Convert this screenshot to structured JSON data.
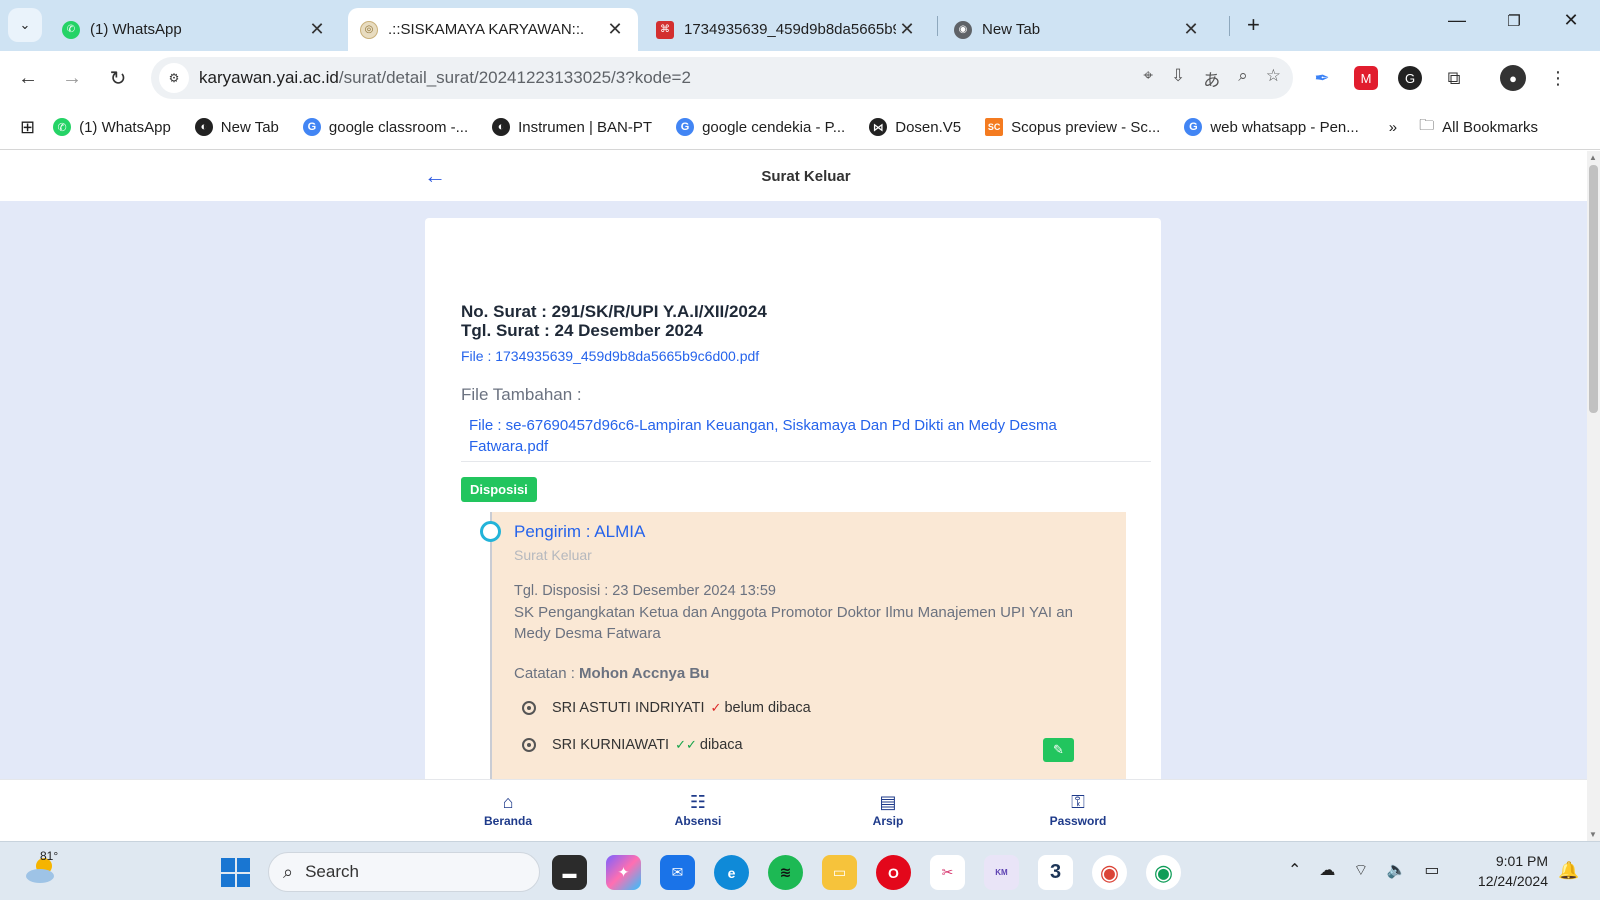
{
  "browser": {
    "tabs": [
      {
        "title": "(1) WhatsApp",
        "favicon_color": "#25D366",
        "favicon_icon": "whatsapp-icon"
      },
      {
        "title": ".::SISKAMAYA KARYAWAN::.",
        "favicon_color": "#c9b07a",
        "favicon_icon": "siskamaya-icon"
      },
      {
        "title": "1734935639_459d9b8da5665b9",
        "favicon_color": "#d32f2f",
        "favicon_icon": "pdf-icon"
      },
      {
        "title": "New Tab",
        "favicon_color": "#5f6368",
        "favicon_icon": "chrome-icon"
      }
    ],
    "url_host": "karyawan.yai.ac.id",
    "url_path": "/surat/detail_surat/20241223133025/3?kode=2",
    "bookmarks": [
      {
        "label": "(1) WhatsApp",
        "color": "#25D366",
        "glyph": "✆"
      },
      {
        "label": "New Tab",
        "color": "#222222",
        "glyph": "◐"
      },
      {
        "label": "google classroom -...",
        "color": "#4285F4",
        "glyph": "G"
      },
      {
        "label": "Instrumen | BAN-PT",
        "color": "#222222",
        "glyph": "◐"
      },
      {
        "label": "google cendekia - P...",
        "color": "#4285F4",
        "glyph": "G"
      },
      {
        "label": "Dosen.V5",
        "color": "#222222",
        "glyph": "⋈"
      },
      {
        "label": "Scopus preview - Sc...",
        "color": "#f47b20",
        "glyph": "SC"
      },
      {
        "label": "web whatsapp - Pen...",
        "color": "#4285F4",
        "glyph": "G"
      }
    ],
    "bookmarks_overflow": "»",
    "all_bookmarks": "All Bookmarks"
  },
  "app": {
    "header_title": "Surat Keluar",
    "surat_no": "No. Surat : 291/SK/R/UPI Y.A.I/XII/2024",
    "surat_tgl": "Tgl. Surat : 24 Desember 2024",
    "file": "File : 1734935639_459d9b8da5665b9c6d00.pdf",
    "file_tambahan_label": "File Tambahan :",
    "file_tambahan": "File : se-67690457d96c6-Lampiran Keuangan, Siskamaya Dan Pd Dikti an Medy Desma Fatwara.pdf",
    "badge": "Disposisi",
    "disposisi": {
      "pengirim": "Pengirim : ALMIA",
      "jenis": "Surat Keluar",
      "tgl": "Tgl. Disposisi : 23 Desember 2024 13:59",
      "perihal": "SK Pengangkatan Ketua dan Anggota Promotor Doktor Ilmu Manajemen UPI YAI an Medy Desma Fatwara",
      "catatan_label": "Catatan : ",
      "catatan": "Mohon Accnya Bu",
      "recipients": [
        {
          "name": "SRI ASTUTI INDRIYATI",
          "status": "belum dibaca",
          "status_color": "#dc2626"
        },
        {
          "name": "SRI KURNIAWATI",
          "status": "dibaca",
          "status_color": "#16a34a"
        }
      ]
    },
    "bottom_nav": [
      {
        "label": "Beranda",
        "icon": "home-icon"
      },
      {
        "label": "Absensi",
        "icon": "list-icon"
      },
      {
        "label": "Arsip",
        "icon": "archive-icon"
      },
      {
        "label": "Password",
        "icon": "lock-icon"
      }
    ]
  },
  "taskbar": {
    "temperature": "81°",
    "search_placeholder": "Search",
    "time": "9:01 PM",
    "date": "12/24/2024"
  }
}
